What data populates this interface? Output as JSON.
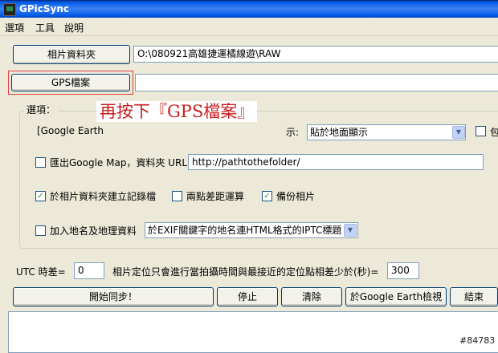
{
  "window": {
    "title": "GPicSync"
  },
  "menu": [
    "選項",
    "工具",
    "說明"
  ],
  "photo_folder": {
    "button": "相片資料夾",
    "path": "O:\\080921高雄捷運橘線遊\\RAW"
  },
  "gps_file": {
    "button": "GPS檔案",
    "path": ""
  },
  "annotation": "再按下『GPS檔案』",
  "options": {
    "label": "選項：",
    "google_earth_label": "[Google Earth",
    "display_label": "示:",
    "display_value": "貼於地面顯示",
    "extra_checkbox_label": "包",
    "google_map": {
      "label": "匯出Google Map，資料夾 URL=",
      "checked": false,
      "url": "http://pathtothefolder/"
    },
    "create_log": {
      "label": "於相片資料夾建立記錄檔",
      "checked": true
    },
    "distance_calc": {
      "label": "兩點差距運算",
      "checked": false
    },
    "backup": {
      "label": "備份相片",
      "checked": true
    },
    "geonames": {
      "label": "加入地名及地理資料",
      "checked": false,
      "dropdown": "於EXIF關鍵字的地名連HTML格式的IPTC標題"
    }
  },
  "utc": {
    "label": "UTC 時差=",
    "value": "0"
  },
  "time_diff": {
    "label": "相片定位只會進行當拍攝時間與最接近的定位點相差少於(秒)=",
    "value": "300"
  },
  "actions": {
    "start": "開始同步！",
    "stop": "停止",
    "clear": "清除",
    "view_ge": "於Google Earth檢視",
    "end": "結束"
  },
  "watermark": "#84783"
}
